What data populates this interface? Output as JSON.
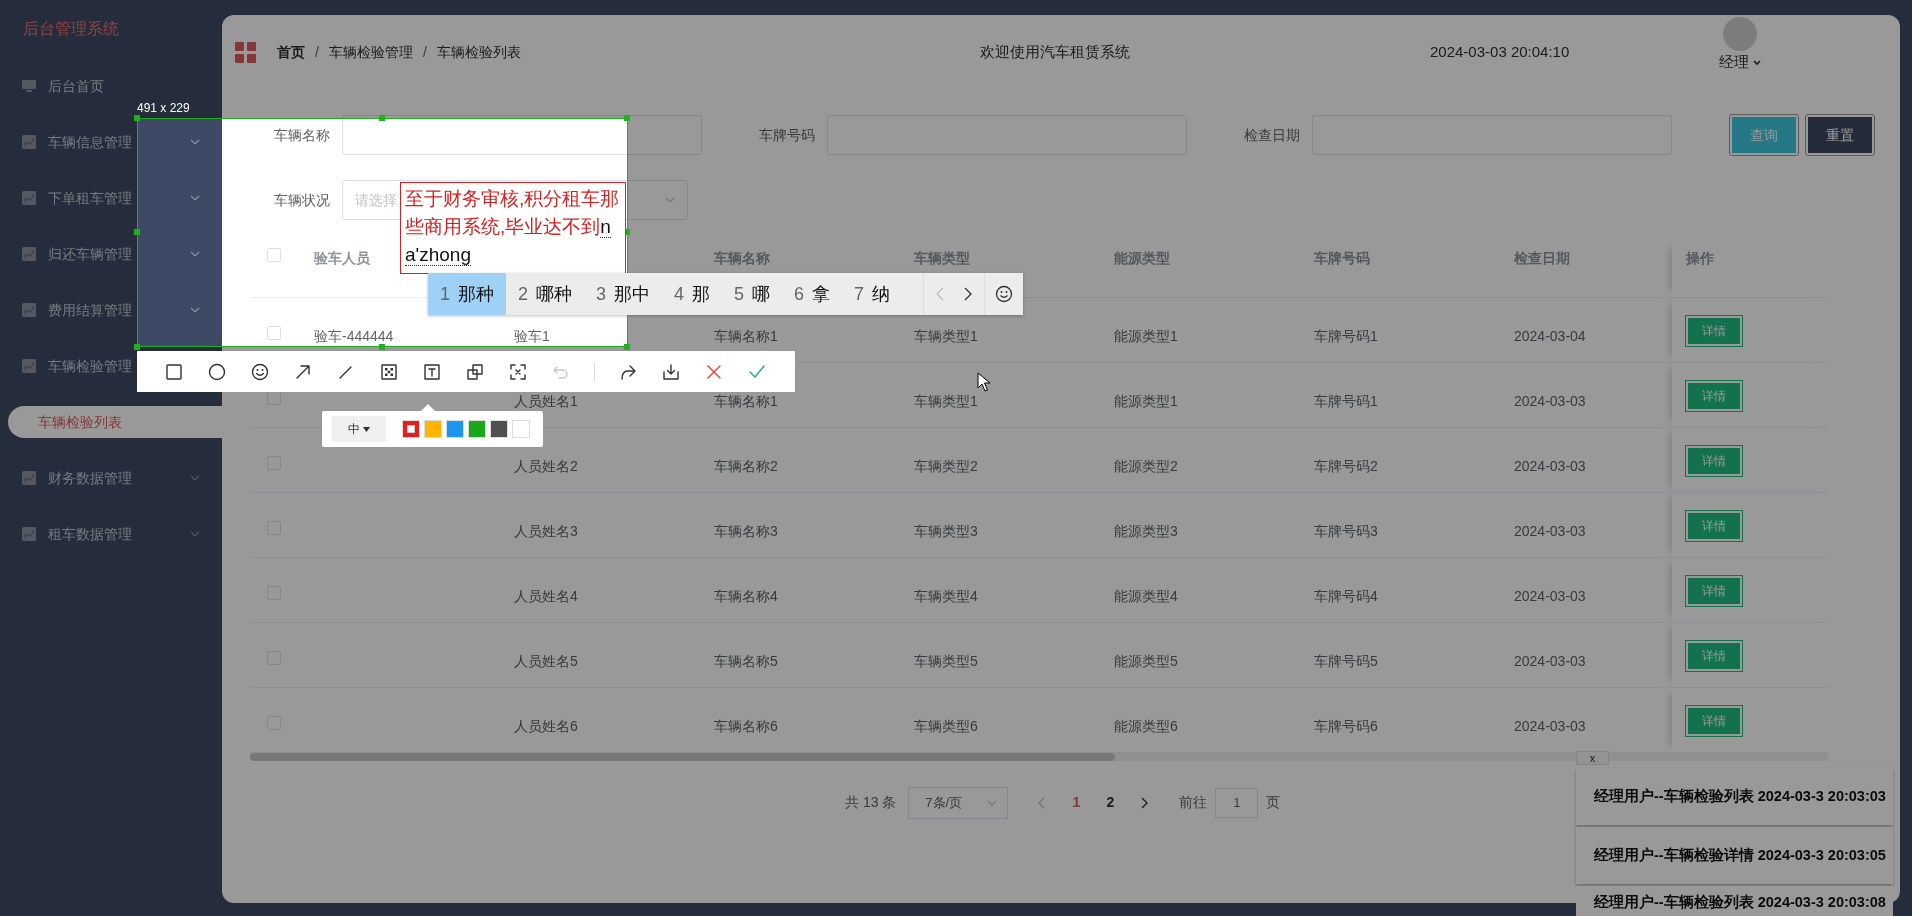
{
  "sidebar": {
    "title": "后台管理系统",
    "items": [
      {
        "label": "后台首页",
        "kind": "link"
      },
      {
        "label": "车辆信息管理",
        "kind": "group"
      },
      {
        "label": "下单租车管理",
        "kind": "group"
      },
      {
        "label": "归还车辆管理",
        "kind": "group"
      },
      {
        "label": "费用结算管理",
        "kind": "group"
      },
      {
        "label": "车辆检验管理",
        "kind": "open",
        "children": [
          {
            "label": "车辆检验列表",
            "selected": true
          }
        ]
      },
      {
        "label": "财务数据管理",
        "kind": "group"
      },
      {
        "label": "租车数据管理",
        "kind": "group"
      }
    ]
  },
  "header": {
    "breadcrumb": [
      "首页",
      "车辆检验管理",
      "车辆检验列表"
    ],
    "separator": "/",
    "title": "欢迎使用汽车租赁系统",
    "datetime": "2024-03-03 20:04:10",
    "user": "经理"
  },
  "filters": [
    {
      "label": "车辆名称",
      "kind": "input"
    },
    {
      "label": "车牌号码",
      "kind": "input"
    },
    {
      "label": "检查日期",
      "kind": "input"
    },
    {
      "label": "车辆状况",
      "kind": "select",
      "placeholder": "请选择"
    }
  ],
  "buttons": [
    {
      "label": "查询",
      "kind": "primary"
    },
    {
      "label": "重置",
      "kind": "dark"
    }
  ],
  "table": {
    "all_checked": false,
    "columns": [
      "验车人员",
      null,
      "车辆名称",
      "车辆类型",
      "能源类型",
      "车牌号码",
      "检查日期",
      "操作"
    ],
    "rows": [
      {
        "checked": false,
        "inspector": "验车-444444",
        "name": "验车1",
        "vehicle": "车辆名称1",
        "type": "车辆类型1",
        "energy": "能源类型1",
        "plate": "车牌号码1",
        "date": "2024-03-04",
        "action": "详情"
      },
      {
        "checked": false,
        "name": "人员姓名1",
        "vehicle": "车辆名称1",
        "type": "车辆类型1",
        "energy": "能源类型1",
        "plate": "车牌号码1",
        "date": "2024-03-03",
        "action": "详情"
      },
      {
        "checked": false,
        "name": "人员姓名2",
        "vehicle": "车辆名称2",
        "type": "车辆类型2",
        "energy": "能源类型2",
        "plate": "车牌号码2",
        "date": "2024-03-03",
        "action": "详情"
      },
      {
        "checked": false,
        "name": "人员姓名3",
        "vehicle": "车辆名称3",
        "type": "车辆类型3",
        "energy": "能源类型3",
        "plate": "车牌号码3",
        "date": "2024-03-03",
        "action": "详情"
      },
      {
        "checked": false,
        "name": "人员姓名4",
        "vehicle": "车辆名称4",
        "type": "车辆类型4",
        "energy": "能源类型4",
        "plate": "车牌号码4",
        "date": "2024-03-03",
        "action": "详情"
      },
      {
        "checked": false,
        "name": "人员姓名5",
        "vehicle": "车辆名称5",
        "type": "车辆类型5",
        "energy": "能源类型5",
        "plate": "车牌号码5",
        "date": "2024-03-03",
        "action": "详情"
      },
      {
        "checked": false,
        "name": "人员姓名6",
        "vehicle": "车辆名称6",
        "type": "车辆类型6",
        "energy": "能源类型6",
        "plate": "车牌号码6",
        "date": "2024-03-03",
        "action": "详情"
      }
    ]
  },
  "pagination": {
    "total": "共 13 条",
    "page_size": "7条/页",
    "prev_disabled": true,
    "next_disabled": false,
    "pages": [
      {
        "label": "1",
        "selected": true
      },
      {
        "label": "2",
        "selected": false
      }
    ],
    "goto_label": "前往",
    "goto_value": "1",
    "goto_suffix": "页"
  },
  "notifications": {
    "close": "x",
    "items": [
      "经理用户--车辆检验列表 2024-03-3 20:03:03",
      "经理用户--车辆检验详情 2024-03-3 20:03:05",
      "经理用户--车辆检验列表 2024-03-3 20:03:08"
    ]
  },
  "capture": {
    "size": "491 x 229",
    "annotation": {
      "text": "至于财务审核,积分租车那些商用系统,毕业达不到",
      "composition": "na'zhong"
    },
    "tools": [
      {
        "kind": "rectangle",
        "disabled": false
      },
      {
        "kind": "ellipse",
        "disabled": false
      },
      {
        "kind": "emoji",
        "disabled": false
      },
      {
        "kind": "arrow",
        "disabled": false
      },
      {
        "kind": "line",
        "disabled": false
      },
      {
        "kind": "mosaic",
        "disabled": false
      },
      {
        "kind": "text",
        "disabled": false
      },
      {
        "kind": "pin",
        "disabled": false
      },
      {
        "kind": "ocr",
        "disabled": false
      },
      {
        "kind": "undo",
        "disabled": true
      },
      {
        "kind": "share",
        "disabled": false
      },
      {
        "kind": "save",
        "disabled": false
      },
      {
        "kind": "cancel",
        "disabled": false
      },
      {
        "kind": "confirm",
        "disabled": false
      }
    ],
    "font_size": "中",
    "colors": [
      {
        "color": "#e81c1c",
        "selected": true
      },
      {
        "color": "#ffb400",
        "selected": false
      },
      {
        "color": "#1e96f0",
        "selected": false
      },
      {
        "color": "#18a818",
        "selected": false
      },
      {
        "color": "#505050",
        "selected": false
      },
      {
        "color": "#ffffff",
        "selected": false
      }
    ]
  },
  "ime": {
    "candidates": [
      {
        "number": "1",
        "text": "那种",
        "selected": true
      },
      {
        "number": "2",
        "text": "哪种",
        "selected": false
      },
      {
        "number": "3",
        "text": "那中",
        "selected": false
      },
      {
        "number": "4",
        "text": "那",
        "selected": false
      },
      {
        "number": "5",
        "text": "哪",
        "selected": false
      },
      {
        "number": "6",
        "text": "拿",
        "selected": false
      },
      {
        "number": "7",
        "text": "纳",
        "selected": false
      }
    ],
    "prev_disabled": true
  }
}
